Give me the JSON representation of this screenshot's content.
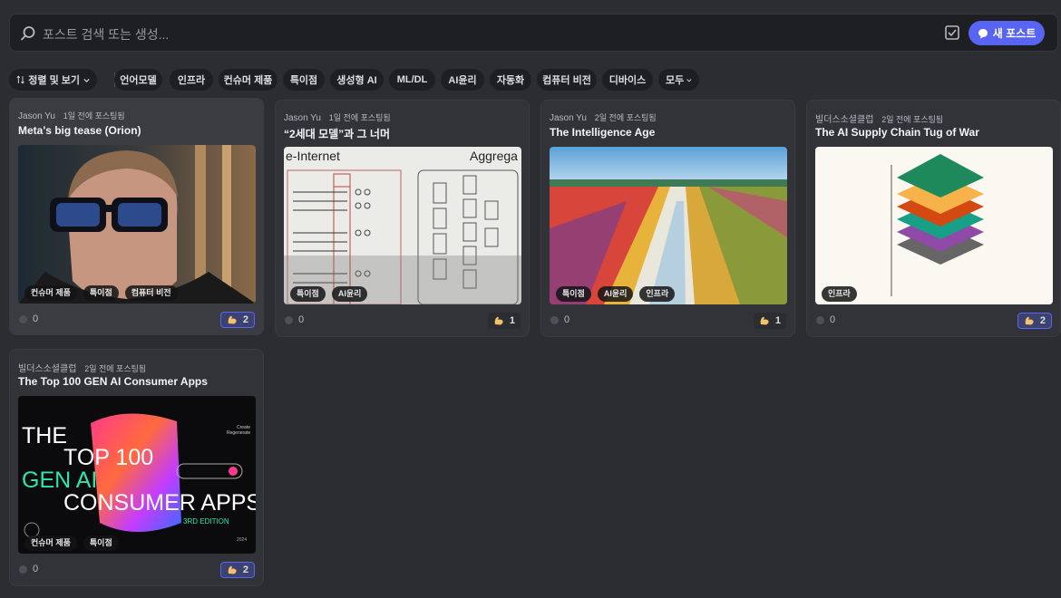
{
  "search": {
    "placeholder": "포스트 검색 또는 생성...",
    "new_post_label": "새 포스트"
  },
  "filters": {
    "sort_label": "정렬 및 보기",
    "tags": [
      "언어모델",
      "인프라",
      "컨슈머 제품",
      "특이점",
      "생성형 AI",
      "ML/DL",
      "AI윤리",
      "자동화",
      "컴퓨터 비전",
      "디바이스"
    ],
    "all_label": "모두"
  },
  "posts": [
    {
      "author": "Jason Yu",
      "time": "1일 전에 포스팅됨",
      "title": "Meta's big tease (Orion)",
      "tags": [
        "컨슈머 제품",
        "특이점",
        "컴퓨터 비전"
      ],
      "comments": "0",
      "likes": "2"
    },
    {
      "author": "Jason Yu",
      "time": "1일 전에 포스팅됨",
      "title": "“2세대 모델”과 그 너머",
      "tags": [
        "특이점",
        "AI윤리"
      ],
      "comments": "0",
      "likes": "1",
      "image_text": [
        "e-Internet",
        "Aggrega"
      ]
    },
    {
      "author": "Jason Yu",
      "time": "2일 전에 포스팅됨",
      "title": "The Intelligence Age",
      "tags": [
        "특이점",
        "AI윤리",
        "인프라"
      ],
      "comments": "0",
      "likes": "1"
    },
    {
      "author": "빌더스소셜클럽",
      "time": "2일 전에 포스팅됨",
      "title": "The AI Supply Chain Tug of War",
      "tags": [
        "인프라"
      ],
      "comments": "0",
      "likes": "2"
    },
    {
      "author": "빌더스소셜클럽",
      "time": "2일 전에 포스팅됨",
      "title": "The Top 100 GEN AI Consumer Apps",
      "tags": [
        "컨슈머 제품",
        "특이점"
      ],
      "comments": "0",
      "likes": "2",
      "image_text": {
        "line1": "THE",
        "line2": "TOP 100",
        "line3": "GEN AI",
        "line4": "CONSUMER APPS",
        "edition": "3RD EDITION",
        "year": "2024",
        "side1": "Create",
        "side2": "Regenerate"
      }
    }
  ]
}
